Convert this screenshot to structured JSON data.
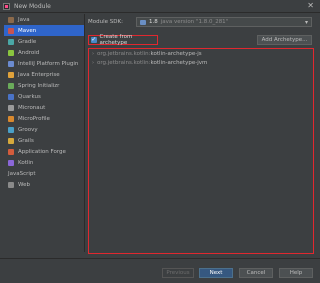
{
  "window": {
    "title": "New Module",
    "close": "✕"
  },
  "sidebar": {
    "items": [
      {
        "label": "Java",
        "icon": "java-folder-icon",
        "color": "#8c6a4b"
      },
      {
        "label": "Maven",
        "icon": "maven-icon",
        "color": "#c75450",
        "selected": true
      },
      {
        "label": "Gradle",
        "icon": "gradle-icon",
        "color": "#4aa7a6"
      },
      {
        "label": "Android",
        "icon": "android-icon",
        "color": "#8ac53f"
      },
      {
        "label": "IntelliJ Platform Plugin",
        "icon": "plugin-icon",
        "color": "#6b8bd0"
      },
      {
        "label": "Java Enterprise",
        "icon": "enterprise-icon",
        "color": "#e0a23b"
      },
      {
        "label": "Spring Initializr",
        "icon": "spring-icon",
        "color": "#6aab5a"
      },
      {
        "label": "Quarkus",
        "icon": "quarkus-icon",
        "color": "#4a73c7"
      },
      {
        "label": "Micronaut",
        "icon": "micronaut-icon",
        "color": "#9a9a9a"
      },
      {
        "label": "MicroProfile",
        "icon": "microprofile-icon",
        "color": "#d9892e"
      },
      {
        "label": "Groovy",
        "icon": "groovy-icon",
        "color": "#4aa0c8"
      },
      {
        "label": "Grails",
        "icon": "grails-icon",
        "color": "#d6a93c"
      },
      {
        "label": "Application Forge",
        "icon": "forge-icon",
        "color": "#d35c3c"
      },
      {
        "label": "Kotlin",
        "icon": "kotlin-icon",
        "color": "#8b67d8"
      },
      {
        "label": "JavaScript",
        "icon": "",
        "color": ""
      },
      {
        "label": "Web",
        "icon": "web-icon",
        "color": "#8a8a8a"
      }
    ]
  },
  "sdk": {
    "label": "Module SDK:",
    "name": "1.8",
    "detail": "java version \"1.8.0_281\"",
    "caret": "▾"
  },
  "archetype_checkbox": {
    "label": "Create from archetype",
    "checked": true,
    "mark": "✓"
  },
  "add_archetype_button": "Add Archetype...",
  "archetypes": [
    {
      "group": "org.jetbrains.kotlin:",
      "artifact": "kotlin-archetype-js",
      "chevron": "›"
    },
    {
      "group": "org.jetbrains.kotlin:",
      "artifact": "kotlin-archetype-jvm",
      "chevron": "›"
    }
  ],
  "buttons": {
    "previous": "Previous",
    "next": "Next",
    "cancel": "Cancel",
    "help": "Help"
  },
  "colors": {
    "selection": "#2f65ca",
    "highlight_border": "#e0282f",
    "primary_button": "#365880"
  }
}
